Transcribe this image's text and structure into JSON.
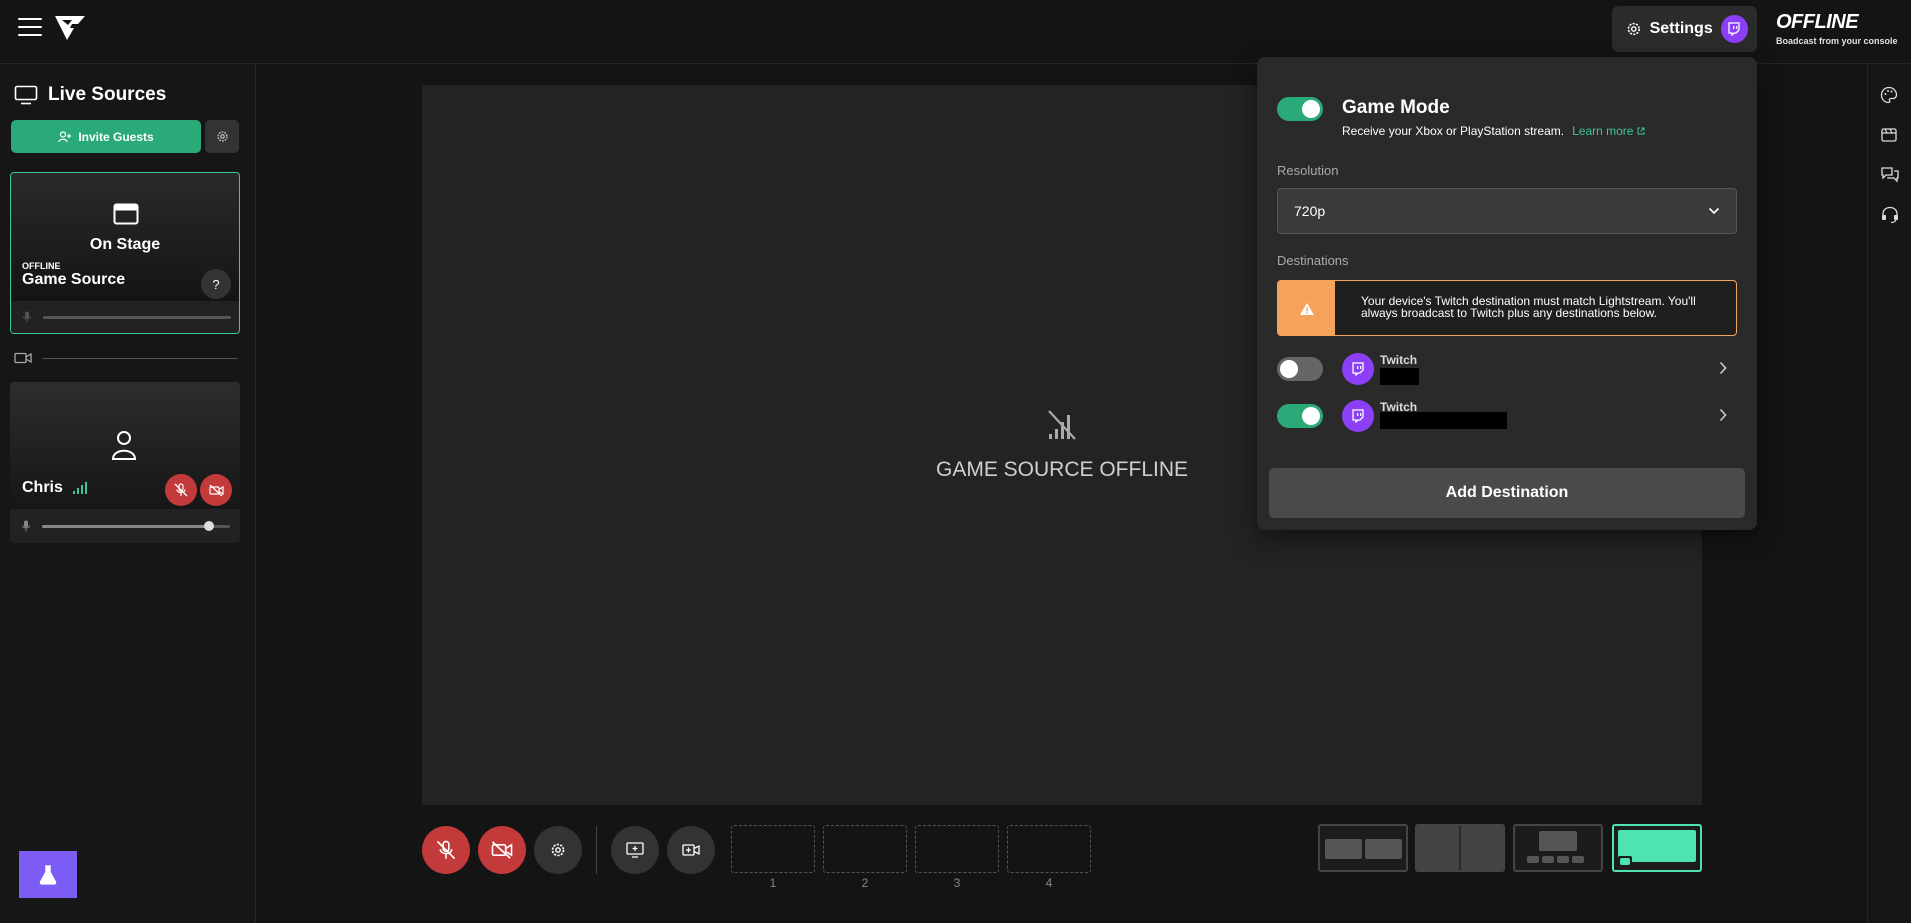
{
  "topbar": {
    "settings_label": "Settings",
    "status_title": "OFFLINE",
    "status_subtitle": "Boadcast from your console"
  },
  "sidebar": {
    "title": "Live Sources",
    "invite_label": "Invite Guests",
    "stage_card": {
      "stage_label": "On Stage",
      "status": "OFFLINE",
      "name": "Game Source",
      "help": "?",
      "volume": 1.0
    },
    "guest_card": {
      "name": "Chris",
      "volume": 0.89
    }
  },
  "stage": {
    "message": "GAME SOURCE OFFLINE"
  },
  "controls": {
    "slots": [
      "1",
      "2",
      "3",
      "4"
    ]
  },
  "settings_panel": {
    "game_mode_title": "Game Mode",
    "game_mode_enabled": true,
    "game_mode_desc": "Receive your Xbox or PlayStation stream.",
    "learn_more": "Learn more",
    "resolution_label": "Resolution",
    "resolution_value": "720p",
    "destinations_label": "Destinations",
    "warning": "Your device's Twitch destination must match Lightstream. You'll always broadcast to Twitch plus any destinations below.",
    "destinations": [
      {
        "platform": "Twitch",
        "enabled": false
      },
      {
        "platform": "Twitch",
        "enabled": true
      }
    ],
    "add_destination": "Add Destination"
  },
  "colors": {
    "accent_green": "#2aaa78",
    "twitch_purple": "#8b3ff7",
    "danger_red": "#c23a3a",
    "warning_orange": "#f5a25c"
  }
}
